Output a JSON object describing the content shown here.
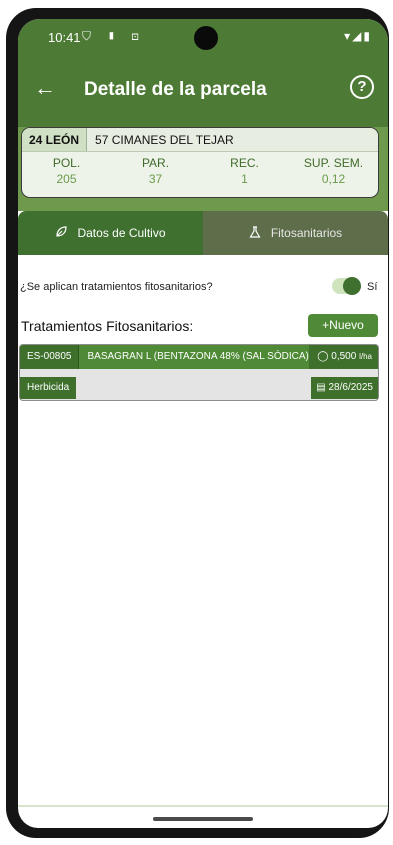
{
  "status": {
    "time": "10:41",
    "left_icons": "⛉ ▮ ⊡",
    "right_icons": "▾◢▮"
  },
  "appbar": {
    "title": "Detalle de la parcela",
    "back_icon": "arrow-left",
    "help_label": "?"
  },
  "parcel": {
    "province": "24 LEÓN",
    "municipality": "57 CIMANES DEL TEJAR",
    "fields": [
      {
        "label": "POL.",
        "value": "205"
      },
      {
        "label": "PAR.",
        "value": "37"
      },
      {
        "label": "REC.",
        "value": "1"
      },
      {
        "label": "SUP. SEM.",
        "value": "0,12"
      }
    ]
  },
  "tabs": [
    {
      "label": "Datos de Cultivo",
      "icon": "leaf-icon",
      "active": true
    },
    {
      "label": "Fitosanitarios",
      "icon": "flask-icon",
      "active": false
    }
  ],
  "question": {
    "text": "¿Se aplican tratamientos fitosanitarios?",
    "toggle_on": true,
    "toggle_label": "Sí"
  },
  "treatments": {
    "title": "Tratamientos Fitosanitarios:",
    "new_button": "+Nuevo",
    "items": [
      {
        "code": "ES-00805",
        "name": "BASAGRAN L (BENTAZONA 48% (SAL SÓDICA))",
        "dose": "0,500",
        "dose_unit": "l/ha",
        "type": "Herbicida",
        "date": "28/6/2025"
      }
    ]
  },
  "colors": {
    "primary": "#4d7a35",
    "tab_active": "#3f7030",
    "tab_inactive": "#5e6e4a",
    "accent": "#4f8a36"
  }
}
